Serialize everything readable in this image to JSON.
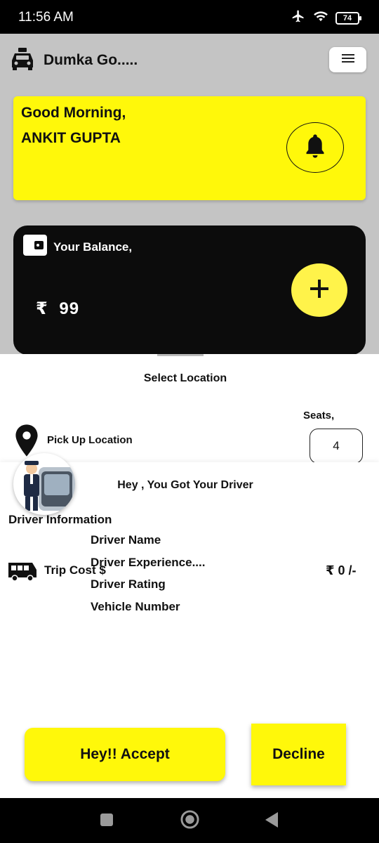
{
  "status_bar": {
    "time": "11:56 AM",
    "battery": "74"
  },
  "header": {
    "title": "Dumka Go....."
  },
  "greeting": {
    "line1": "Good Morning,",
    "name": "ANKIT GUPTA"
  },
  "balance": {
    "label": "Your Balance,",
    "currency": "₹",
    "amount": "99"
  },
  "location": {
    "title": "Select Location",
    "seats_label": "Seats,",
    "pickup_label": "Pick Up Location",
    "seats_value": "4"
  },
  "driver": {
    "heading": "Hey , You Got Your Driver",
    "info_title": "Driver Information",
    "name_label": "Driver Name",
    "experience_label": "Driver Experience....",
    "rating_label": "Driver  Rating",
    "vehicle_label": "Vehicle Number"
  },
  "trip": {
    "label": "Trip Cost $",
    "cost": "₹ 0 /-"
  },
  "actions": {
    "accept": "Hey!! Accept",
    "decline": "Decline"
  },
  "colors": {
    "accent_yellow": "#fff80a",
    "card_dark": "#0c0c0c",
    "backdrop": "#c4c4c4"
  },
  "icons": [
    "airplane-icon",
    "wifi-icon",
    "battery-icon",
    "taxi-icon",
    "menu-icon",
    "bell-icon",
    "wallet-icon",
    "plus-icon",
    "location-pin-icon",
    "driver-avatar-image",
    "bus-icon",
    "square-nav-icon",
    "circle-nav-icon",
    "back-nav-icon"
  ]
}
